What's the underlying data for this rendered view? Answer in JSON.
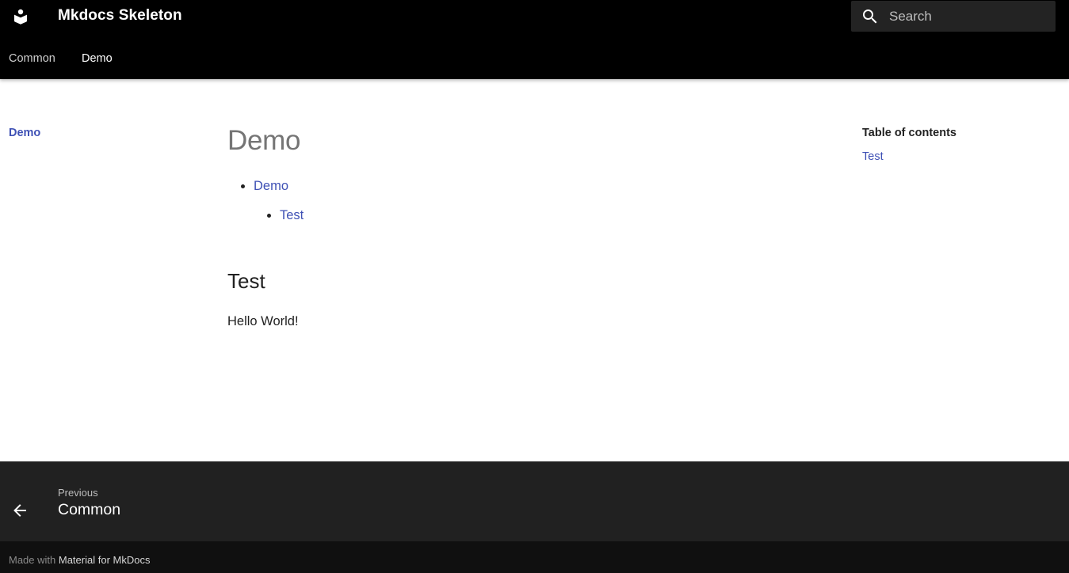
{
  "header": {
    "title": "Mkdocs Skeleton",
    "logo_icon": "book-icon",
    "search": {
      "placeholder": "Search",
      "icon": "search-icon"
    }
  },
  "tabs": [
    {
      "label": "Common",
      "active": false
    },
    {
      "label": "Demo",
      "active": true
    }
  ],
  "sidebar": {
    "active_item": "Demo"
  },
  "content": {
    "title": "Demo",
    "toc_list": {
      "item": "Demo",
      "subitem": "Test"
    },
    "section_heading": "Test",
    "paragraph": "Hello World!"
  },
  "toc": {
    "title": "Table of contents",
    "items": [
      "Test"
    ]
  },
  "footer": {
    "previous": {
      "direction": "Previous",
      "title": "Common",
      "icon": "arrow-left-icon"
    },
    "made_with": "Made with",
    "made_with_link": "Material for MkDocs"
  },
  "colors": {
    "header_bg": "#000000",
    "accent": "#3f51b5",
    "footer_bg": "#212121",
    "meta_bg": "#101010"
  }
}
